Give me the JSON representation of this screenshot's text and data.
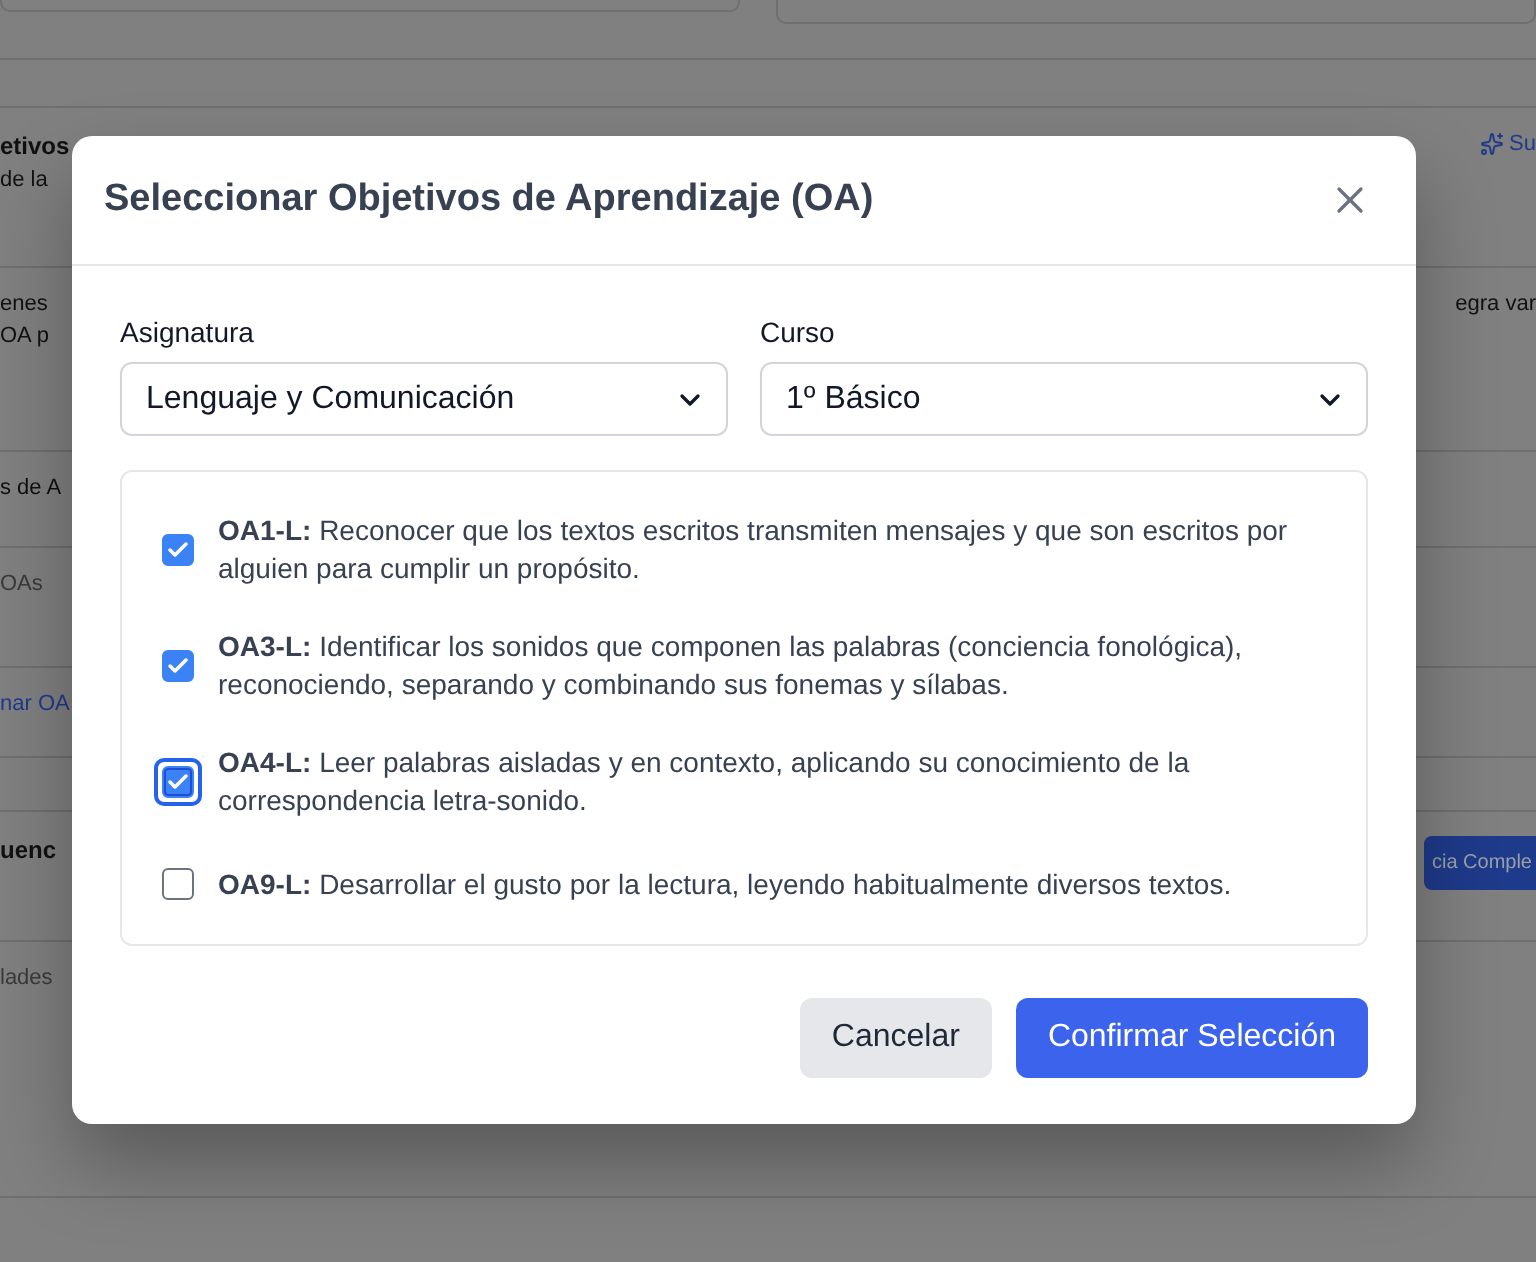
{
  "background": {
    "sections": [
      {
        "left": [
          {
            "text": "etivos",
            "kind": "heading"
          },
          {
            "text": "de la",
            "kind": "text"
          }
        ],
        "right": {
          "text": "Su",
          "kind": "link"
        }
      },
      {
        "left": [
          {
            "text": "enes",
            "kind": "body"
          },
          {
            "text": "OA p",
            "kind": "body"
          }
        ],
        "right": {
          "text": "egra var",
          "kind": "body"
        }
      },
      {
        "left": [
          {
            "text": "s de A",
            "kind": "text"
          }
        ]
      },
      {
        "left": [
          {
            "text": "OAs",
            "kind": "muted"
          }
        ]
      },
      {
        "left": [
          {
            "text": "nar OA",
            "kind": "link"
          }
        ]
      },
      {
        "left": [
          {
            "text": "uenc",
            "kind": "heading"
          }
        ],
        "right": {
          "text": "cia Comple",
          "kind": "button"
        }
      },
      {
        "left": [
          {
            "text": "lades",
            "kind": "muted"
          }
        ]
      }
    ]
  },
  "modal": {
    "title": "Seleccionar Objetivos de Aprendizaje (OA)",
    "fields": [
      {
        "label": "Asignatura",
        "value": "Lenguaje y Comunicación"
      },
      {
        "label": "Curso",
        "value": "1º Básico"
      }
    ],
    "objectives": [
      {
        "code": "OA1-L:",
        "text": "Reconocer que los textos escritos transmiten mensajes y que son escritos por alguien para cumplir un propósito.",
        "checked": true,
        "focused": false
      },
      {
        "code": "OA3-L:",
        "text": "Identificar los sonidos que componen las palabras (conciencia fonológica), reconociendo, separando y combinando sus fonemas y sílabas.",
        "checked": true,
        "focused": false
      },
      {
        "code": "OA4-L:",
        "text": "Leer palabras aisladas y en contexto, aplicando su conocimiento de la correspondencia letra-sonido.",
        "checked": true,
        "focused": true
      },
      {
        "code": "OA9-L:",
        "text": "Desarrollar el gusto por la lectura, leyendo habitualmente diversos textos.",
        "checked": false,
        "focused": false
      }
    ],
    "buttons": [
      {
        "label": "Cancelar",
        "kind": "secondary"
      },
      {
        "label": "Confirmar Selección",
        "kind": "primary"
      }
    ]
  }
}
